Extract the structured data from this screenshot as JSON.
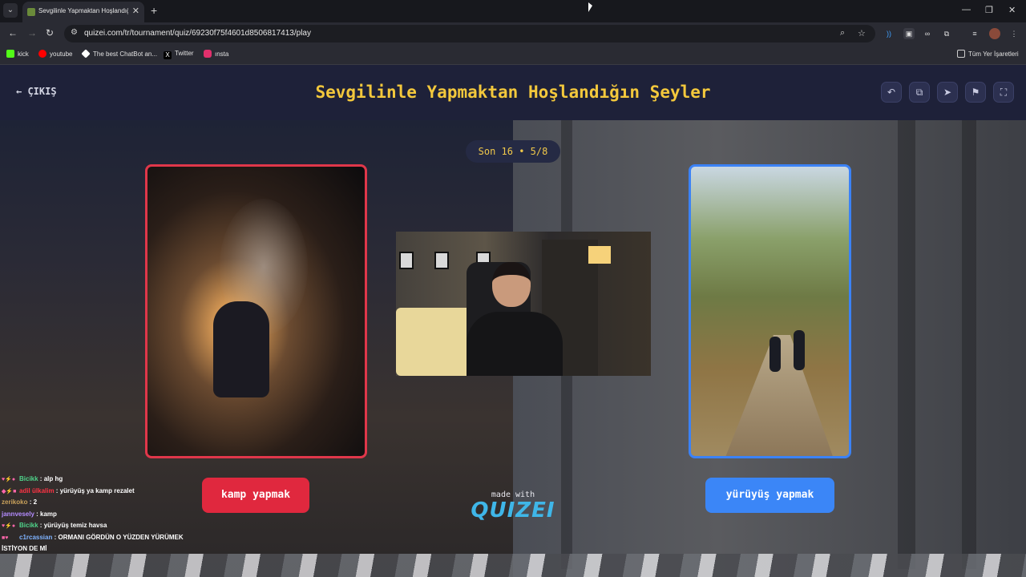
{
  "browser": {
    "tab_title": "Sevgilinle Yapmaktan Hoşlandığ",
    "url": "quizei.com/tr/tournament/quiz/69230f75f4601d8506817413/play",
    "bookmarks": [
      {
        "label": "kick",
        "color": "#53fc18"
      },
      {
        "label": "youtube",
        "color": "#ff0000"
      },
      {
        "label": "The best ChatBot an...",
        "color": "#ffffff"
      },
      {
        "label": "Twitter",
        "color": "#ffffff"
      },
      {
        "label": "ınsta",
        "color": "#e1306c"
      }
    ],
    "all_bookmarks": "Tüm Yer İşaretleri"
  },
  "header": {
    "back_label": "ÇIKIŞ",
    "title": "Sevgilinle Yapmaktan Hoşlandığın Şeyler",
    "buttons": [
      "undo-icon",
      "share-icon",
      "send-icon",
      "flag-icon",
      "fullscreen-icon"
    ]
  },
  "round": {
    "label": "Son 16 • 5/8"
  },
  "choices": {
    "left": {
      "label": "kamp yapmak",
      "color": "#e0283e"
    },
    "right": {
      "label": "yürüyüş yapmak",
      "color": "#3b86f7"
    }
  },
  "branding": {
    "made_with": "made with",
    "logo": "QUIZEI"
  },
  "chat": [
    {
      "user": "Bicikk",
      "user_color": "#4fd38a",
      "message": "alp hg"
    },
    {
      "user": "adil ülkalim",
      "user_color": "#ff3344",
      "message": "yürüyüş ya kamp rezalet"
    },
    {
      "user": "zerikoko",
      "user_color": "#c9a15b",
      "message": "2"
    },
    {
      "user": "jannvesely",
      "user_color": "#b48cff",
      "message": "kamp"
    },
    {
      "user": "Bicikk",
      "user_color": "#4fd38a",
      "message": "yürüyüş temiz havsa"
    },
    {
      "user": "c1rcassian",
      "user_color": "#7fb3ff",
      "message": "ORMANI GÖRDÜN O YÜZDEN YÜRÜMEK"
    },
    {
      "user": "",
      "user_color": "#ffffff",
      "message": "İSTİYON DE Mİ"
    }
  ]
}
